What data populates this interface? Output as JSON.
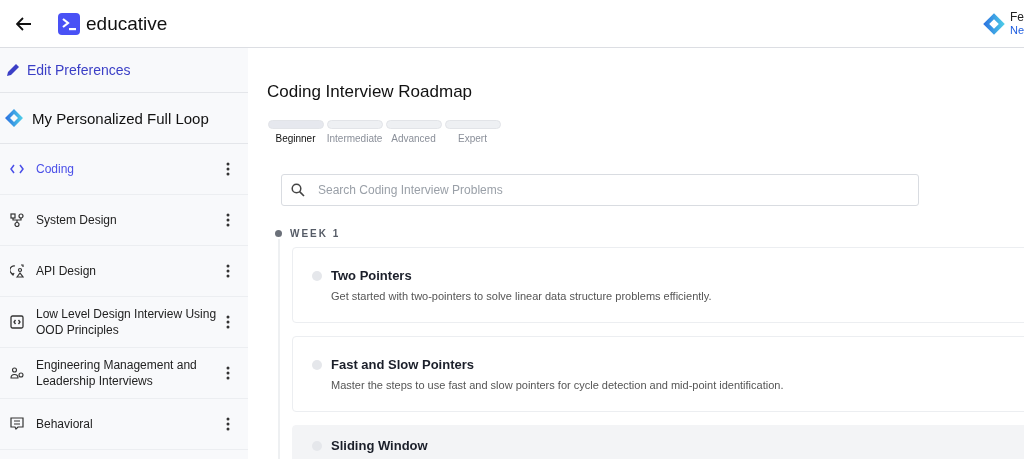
{
  "header": {
    "brand": "educative",
    "user_name": "Fe",
    "user_plan": "Ne"
  },
  "sidebar": {
    "edit_link": "Edit Preferences",
    "loop_title": "My Personalized Full Loop",
    "items": [
      {
        "label": "Coding",
        "selected": true
      },
      {
        "label": "System Design",
        "selected": false
      },
      {
        "label": "API Design",
        "selected": false
      },
      {
        "label": "Low Level Design Interview Using OOD Principles",
        "selected": false
      },
      {
        "label": "Engineering Management and Leadership Interviews",
        "selected": false
      },
      {
        "label": "Behavioral",
        "selected": false
      }
    ]
  },
  "main": {
    "title": "Coding Interview Roadmap",
    "levels": [
      {
        "label": "Beginner",
        "selected": true
      },
      {
        "label": "Intermediate",
        "selected": false
      },
      {
        "label": "Advanced",
        "selected": false
      },
      {
        "label": "Expert",
        "selected": false
      }
    ],
    "search": {
      "placeholder": "Search Coding Interview Problems"
    },
    "week": "WEEK 1",
    "lessons": [
      {
        "title": "Two Pointers",
        "description": "Get started with two-pointers to solve linear data structure problems efficiently.",
        "highlighted": false
      },
      {
        "title": "Fast and Slow Pointers",
        "description": "Master the steps to use fast and slow pointers for cycle detection and mid-point identification.",
        "highlighted": false
      },
      {
        "title": "Sliding Window",
        "highlighted": true
      }
    ]
  }
}
